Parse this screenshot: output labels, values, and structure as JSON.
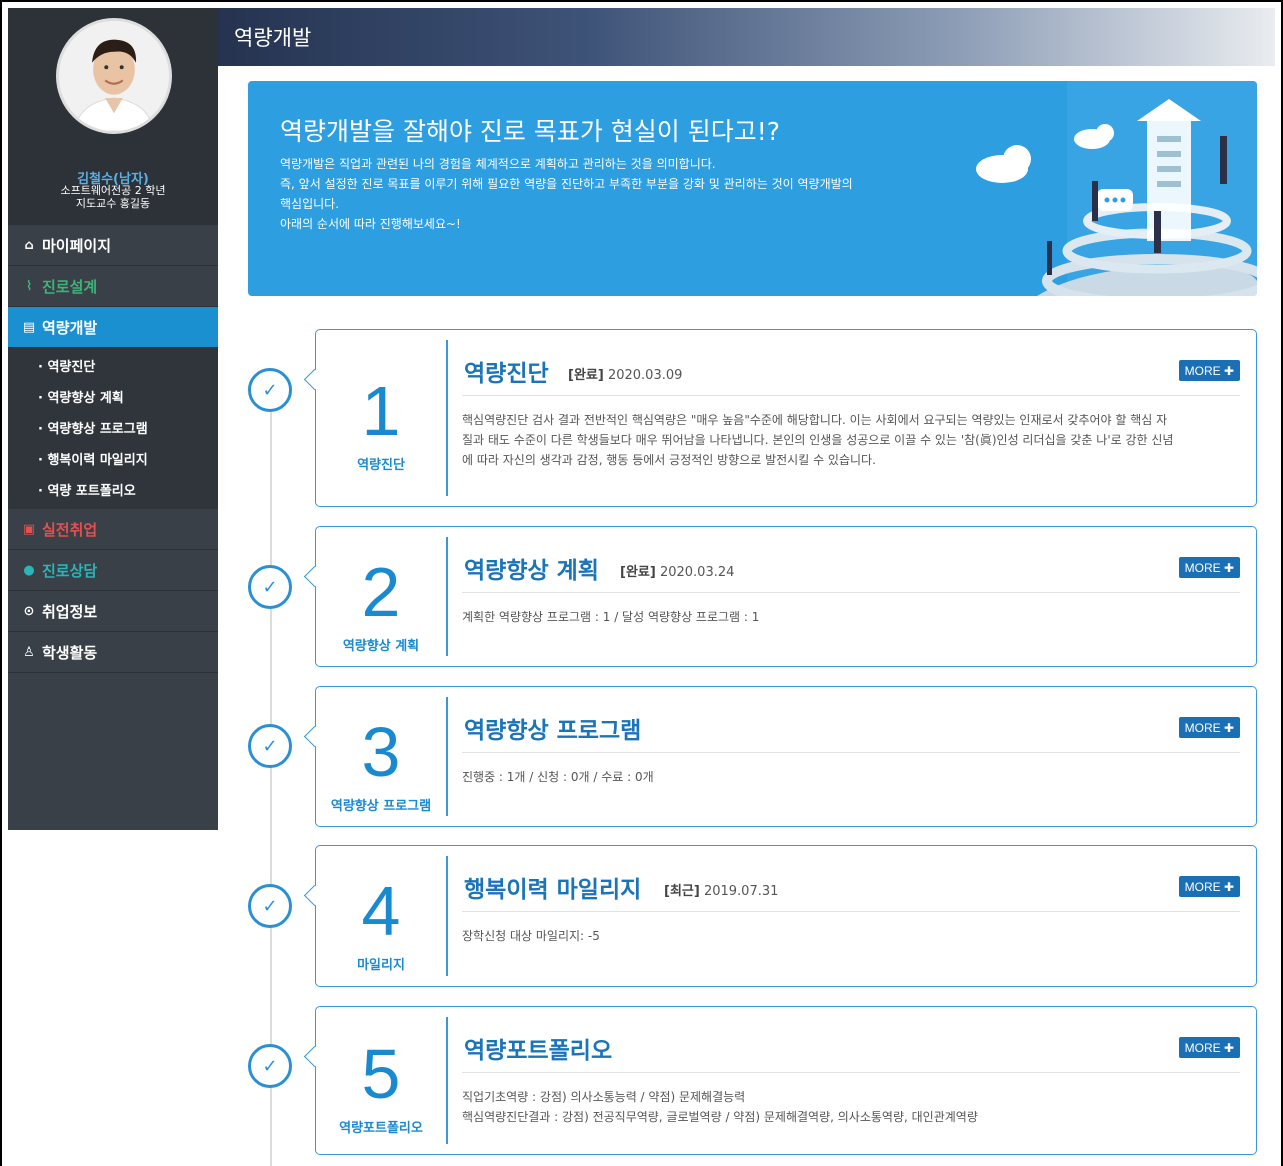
{
  "profile": {
    "name": "김철수(남자)",
    "line1": "소프트웨어전공 2 학년",
    "line2": "지도교수 홍길동"
  },
  "menu": [
    {
      "label": "마이페이지",
      "icon": "home-icon",
      "glyph": "⌂"
    },
    {
      "label": "진로설계",
      "icon": "chart-icon",
      "glyph": "⌇"
    },
    {
      "label": "역량개발",
      "icon": "bar-chart-icon",
      "glyph": "▤"
    }
  ],
  "submenu": [
    "· 역량진단",
    "· 역량향상 계획",
    "· 역량향상 프로그램",
    "· 행복이력 마일리지",
    "· 역량 포트폴리오"
  ],
  "menu2": [
    {
      "label": "실전취업",
      "icon": "id-card-icon",
      "glyph": "▣"
    },
    {
      "label": "진로상담",
      "icon": "chat-icon",
      "glyph": "●"
    },
    {
      "label": "취업정보",
      "icon": "info-icon",
      "glyph": "⊙"
    },
    {
      "label": "학생활동",
      "icon": "users-icon",
      "glyph": "♙"
    }
  ],
  "header": {
    "title": "역량개발"
  },
  "banner": {
    "title": "역량개발을 잘해야 진로 목표가 현실이 된다고!?",
    "lines": [
      "역량개발은 직업과 관련된 나의 경험을 체계적으로 계획하고 관리하는 것을 의미합니다.",
      "즉, 앞서 설정한 진로 목표를 이루기 위해 필요한 역량을 진단하고 부족한 부분을 강화 및 관리하는 것이 역량개발의",
      "핵심입니다.",
      "아래의 순서에 따라 진행해보세요~!"
    ]
  },
  "more_label": "MORE ✚",
  "check_glyph": "✓",
  "cards": [
    {
      "num": "1",
      "label": "역량진단",
      "title": "역량진단",
      "status": "[완료]",
      "date": "2020.03.09",
      "body": [
        "핵심역량진단 검사 결과 전반적인 핵심역량은 \"매우 높음\"수준에 해당합니다. 이는 사회에서 요구되는 역량있는 인재로서 갖추어야 할 핵심 자",
        "질과 태도 수준이 다른 학생들보다 매우 뛰어남을 나타냅니다. 본인의 인생을 성공으로 이끌 수 있는 '참(眞)인성 리더십을 갖춘 나'로 강한 신념",
        "에 따라 자신의 생각과 감정, 행동 등에서 긍정적인 방향으로 발전시킬 수 있습니다."
      ]
    },
    {
      "num": "2",
      "label": "역량향상 계획",
      "title": "역량향상 계획",
      "status": "[완료]",
      "date": "2020.03.24",
      "body": [
        "계획한 역량향상 프로그램 : 1 / 달성 역량향상 프로그램 : 1"
      ]
    },
    {
      "num": "3",
      "label": "역량향상 프로그램",
      "title": "역량향상 프로그램",
      "status": "",
      "date": "",
      "body": [
        "진행중 : 1개 / 신청 : 0개 / 수료 : 0개"
      ]
    },
    {
      "num": "4",
      "label": "마일리지",
      "title": "행복이력 마일리지",
      "status": "[최근]",
      "date": "2019.07.31",
      "body": [
        "장학신청 대상 마일리지: -5"
      ]
    },
    {
      "num": "5",
      "label": "역량포트폴리오",
      "title": "역량포트폴리오",
      "status": "",
      "date": "",
      "body": [
        "직업기초역량 : 강점) 의사소통능력 / 약점) 문제해결능력",
        "핵심역량진단결과 : 강점) 전공직무역량, 글로벌역량 / 약점) 문제해결역량, 의사소통역량, 대인관계역량"
      ]
    }
  ]
}
